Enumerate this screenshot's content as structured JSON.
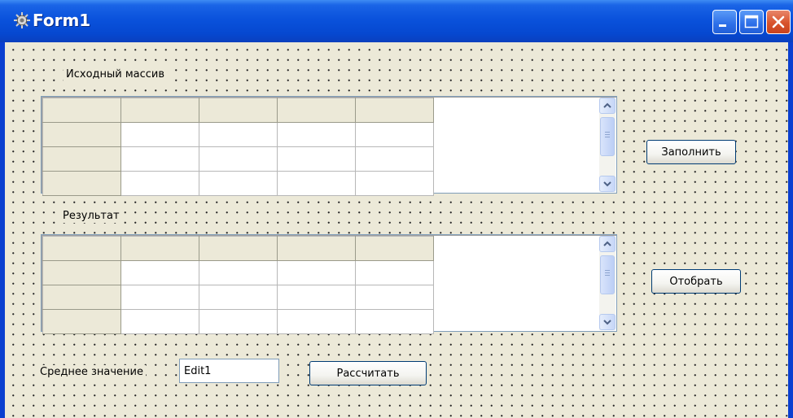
{
  "window": {
    "title": "Form1"
  },
  "labels": {
    "source_array": "Исходный массив",
    "result": "Результат",
    "average": "Среднее значение"
  },
  "buttons": {
    "fill": "Заполнить",
    "select": "Отобрать",
    "calculate": "Рассчитать"
  },
  "average_edit": {
    "value": "Edit1"
  },
  "icons": {
    "window_icon": "form-icon",
    "minimize": "minimize-icon",
    "maximize": "maximize-icon",
    "close": "close-icon",
    "scroll_up": "chevron-up-icon",
    "scroll_down": "chevron-down-icon"
  },
  "colors": {
    "titlebar": "#0a52dc",
    "form_background": "#ece9d8",
    "close_button": "#d8532c"
  }
}
